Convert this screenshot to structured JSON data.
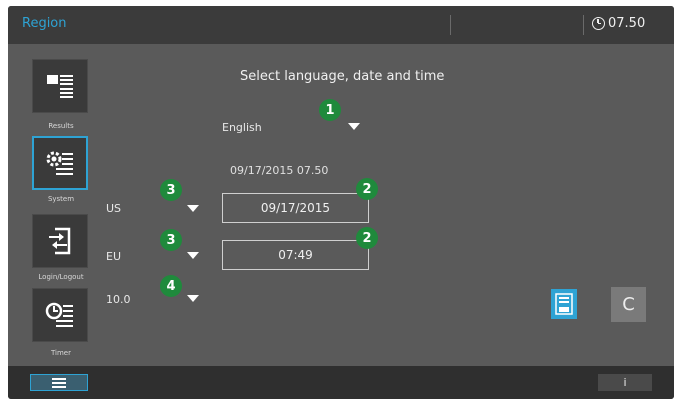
{
  "header": {
    "title": "Region",
    "clock": "07.50"
  },
  "sidebar": {
    "items": [
      {
        "label": "Results",
        "icon": "results-list-icon"
      },
      {
        "label": "System",
        "icon": "system-gear-list-icon",
        "active": true
      },
      {
        "label": "Login/Logout",
        "icon": "login-logout-icon"
      },
      {
        "label": "Timer",
        "icon": "timer-list-icon"
      }
    ]
  },
  "main": {
    "heading": "Select language, date and time",
    "language": {
      "value": "English",
      "badge": "1"
    },
    "current_datetime": "09/17/2015 07.50",
    "date_row": {
      "format": "US",
      "value": "09/17/2015",
      "format_badge": "3",
      "field_badge": "2"
    },
    "time_row": {
      "format": "EU",
      "value": "07:49",
      "format_badge": "3",
      "field_badge": "2"
    },
    "number_row": {
      "format": "10.0",
      "format_badge": "4"
    }
  },
  "actions": {
    "save_icon": "save-icon",
    "cancel_label": "C"
  },
  "footer": {
    "menu_icon": "menu-icon",
    "info_label": "i"
  },
  "colors": {
    "accent": "#2ea3d4",
    "badge": "#1f8a3c",
    "background": "#5a5a5a"
  }
}
